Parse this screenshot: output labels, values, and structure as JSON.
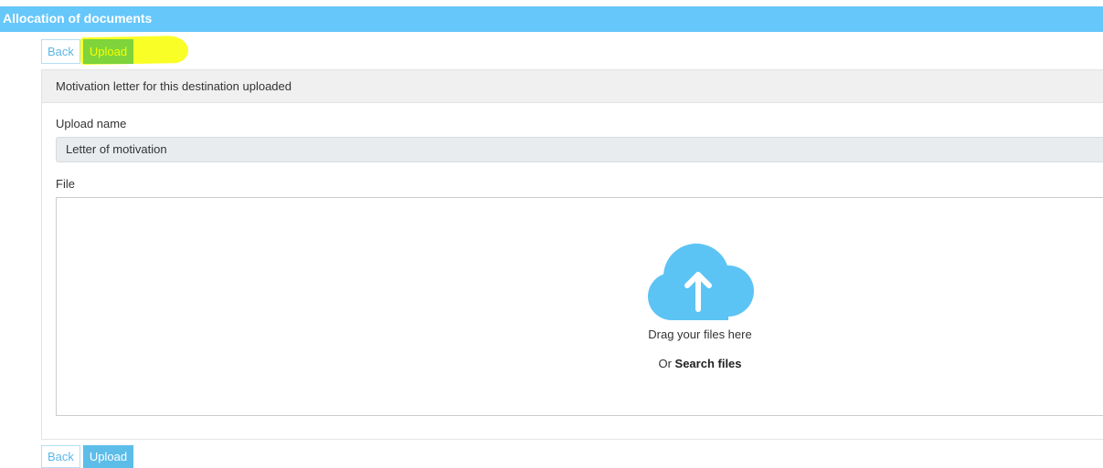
{
  "header": {
    "title": "Allocation of documents"
  },
  "toolbar_top": {
    "back_label": "Back",
    "upload_label": "Upload"
  },
  "panel": {
    "heading": "Motivation letter for this destination uploaded",
    "upload_name_label": "Upload name",
    "upload_name_value": "Letter of motivation",
    "file_label": "File",
    "dropzone": {
      "icon": "cloud-upload-icon",
      "drag_text": "Drag your files here",
      "or_text": "Or",
      "search_link": "Search files"
    }
  },
  "toolbar_bottom": {
    "back_label": "Back",
    "upload_label": "Upload"
  },
  "colors": {
    "header_bg": "#66c7fa",
    "button_primary": "#5cbde9",
    "cloud_icon": "#5cc3f5",
    "highlight": "#f8ff00"
  }
}
